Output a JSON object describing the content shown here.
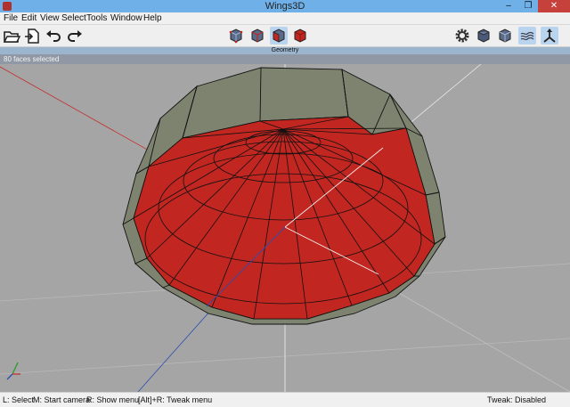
{
  "window": {
    "title": "Wings3D"
  },
  "menu": [
    "File",
    "Edit",
    "View",
    "Select",
    "Tools",
    "Window",
    "Help"
  ],
  "toolbar": {
    "left_icons": [
      "open-folder-icon",
      "import-icon",
      "undo-icon",
      "redo-icon"
    ],
    "selection_modes": [
      "vertex-mode-icon",
      "edge-mode-icon",
      "face-mode-icon",
      "body-mode-icon"
    ],
    "right_icons": [
      "settings-gear-icon",
      "cube-shaded-icon",
      "cube-wire-icon",
      "groundplane-icon",
      "axes-icon"
    ]
  },
  "geometry_tab": {
    "label": "Geometry"
  },
  "info": {
    "text": "80 faces selected"
  },
  "status": {
    "left_select": "L: Select",
    "middle_camera": "M: Start camera",
    "right_menu": "R: Show menu",
    "tweak_hint": "[Alt]+R: Tweak menu",
    "tweak_state": "Tweak: Disabled"
  },
  "colors": {
    "selected_face": "#c22620",
    "mesh_face": "#7d836e",
    "background": "#a5a5a5"
  }
}
